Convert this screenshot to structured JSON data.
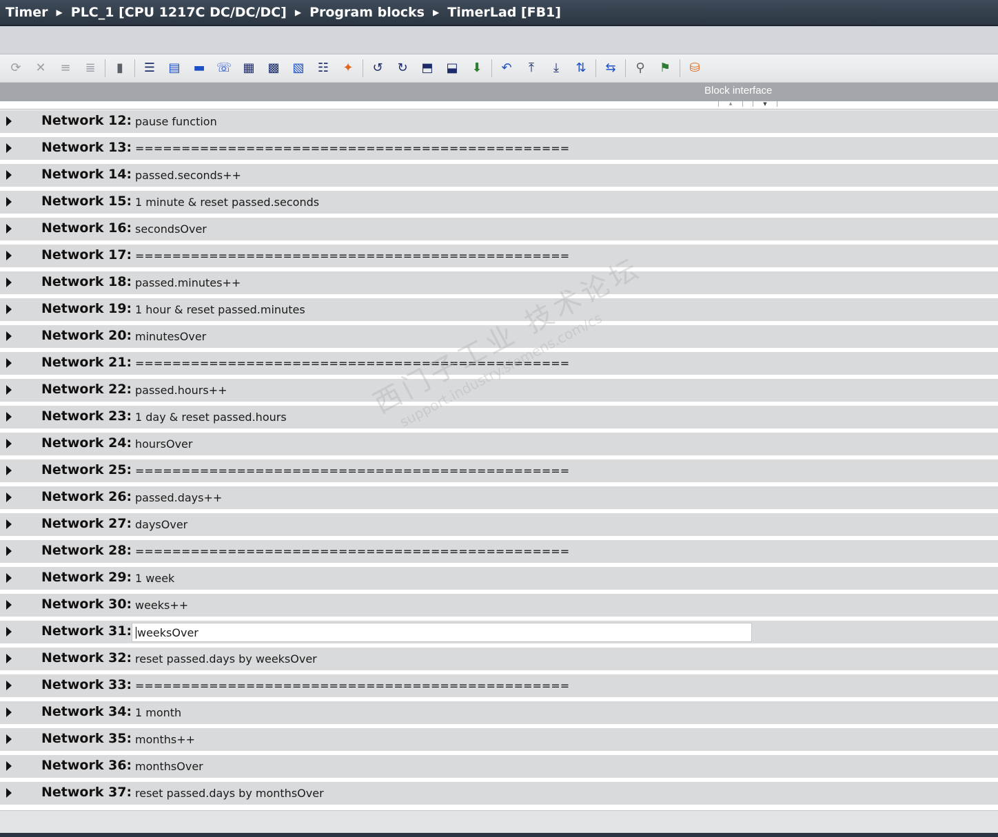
{
  "breadcrumb": [
    "Timer",
    "PLC_1 [CPU 1217C DC/DC/DC]",
    "Program blocks",
    "TimerLad [FB1]"
  ],
  "toolbar": {
    "buttons": [
      {
        "icon": "insert-network-icon",
        "glyph": "⟳",
        "tone": "dim"
      },
      {
        "icon": "delete-network-icon",
        "glyph": "✕",
        "tone": "dim"
      },
      {
        "icon": "insert-row-icon",
        "glyph": "≡",
        "tone": "dim"
      },
      {
        "icon": "append-row-icon",
        "glyph": "≣",
        "tone": "dim"
      },
      {
        "icon": "absolute-operands-icon",
        "glyph": "▮",
        "tone": "gray"
      },
      {
        "icon": "expand-all-icon",
        "glyph": "☰",
        "tone": "navy"
      },
      {
        "icon": "collapse-all-icon",
        "glyph": "▤",
        "tone": "blue"
      },
      {
        "icon": "favorites-icon",
        "glyph": "▬",
        "tone": "blue"
      },
      {
        "icon": "comments-icon",
        "glyph": "☏",
        "tone": "blue"
      },
      {
        "icon": "network-comments-icon",
        "glyph": "▦",
        "tone": "navy"
      },
      {
        "icon": "operand-view-icon",
        "glyph": "▩",
        "tone": "navy"
      },
      {
        "icon": "tag-info-icon",
        "glyph": "▧",
        "tone": "blue"
      },
      {
        "icon": "list-icon",
        "glyph": "☷",
        "tone": "navy"
      },
      {
        "icon": "snapshot-icon",
        "glyph": "✦",
        "tone": "orange"
      },
      {
        "icon": "first-cycle-icon",
        "glyph": "↺",
        "tone": "navy"
      },
      {
        "icon": "step-icon",
        "glyph": "↻",
        "tone": "navy"
      },
      {
        "icon": "load-snapshot-icon",
        "glyph": "⬒",
        "tone": "navy"
      },
      {
        "icon": "save-snapshot-icon",
        "glyph": "⬓",
        "tone": "navy"
      },
      {
        "icon": "compile-icon",
        "glyph": "⬇",
        "tone": "green"
      },
      {
        "icon": "go-to-error-icon",
        "glyph": "↶",
        "tone": "blue"
      },
      {
        "icon": "first-network-icon",
        "glyph": "⤒",
        "tone": "navy"
      },
      {
        "icon": "next-network-icon",
        "glyph": "⤓",
        "tone": "navy"
      },
      {
        "icon": "call-hierarchy-icon",
        "glyph": "⇅",
        "tone": "blue"
      },
      {
        "icon": "jump-back-icon",
        "glyph": "⇆",
        "tone": "blue"
      },
      {
        "icon": "cross-reference-icon",
        "glyph": "⚲",
        "tone": "gray"
      },
      {
        "icon": "monitoring-icon",
        "glyph": "⚑",
        "tone": "green"
      },
      {
        "icon": "database-icon",
        "glyph": "⛁",
        "tone": "orange"
      }
    ]
  },
  "interface_panel": {
    "label": "Block interface"
  },
  "networks": [
    {
      "label": "Network 12:",
      "comment": "pause function"
    },
    {
      "label": "Network 13:",
      "comment": "==============================================="
    },
    {
      "label": "Network 14:",
      "comment": "passed.seconds++"
    },
    {
      "label": "Network 15:",
      "comment": "1 minute & reset passed.seconds"
    },
    {
      "label": "Network 16:",
      "comment": "secondsOver"
    },
    {
      "label": "Network 17:",
      "comment": "==============================================="
    },
    {
      "label": "Network 18:",
      "comment": "passed.minutes++"
    },
    {
      "label": "Network 19:",
      "comment": "1 hour & reset passed.minutes"
    },
    {
      "label": "Network 20:",
      "comment": "minutesOver"
    },
    {
      "label": "Network 21:",
      "comment": "==============================================="
    },
    {
      "label": "Network 22:",
      "comment": "passed.hours++"
    },
    {
      "label": "Network 23:",
      "comment": "1 day & reset passed.hours"
    },
    {
      "label": "Network 24:",
      "comment": "hoursOver"
    },
    {
      "label": "Network 25:",
      "comment": "==============================================="
    },
    {
      "label": "Network 26:",
      "comment": "passed.days++"
    },
    {
      "label": "Network 27:",
      "comment": "daysOver"
    },
    {
      "label": "Network 28:",
      "comment": "==============================================="
    },
    {
      "label": "Network 29:",
      "comment": "1 week"
    },
    {
      "label": "Network 30:",
      "comment": "weeks++"
    },
    {
      "label": "Network 31:",
      "comment": "weeksOver",
      "editing": true
    },
    {
      "label": "Network 32:",
      "comment": "reset passed.days by weeksOver"
    },
    {
      "label": "Network 33:",
      "comment": "==============================================="
    },
    {
      "label": "Network 34:",
      "comment": "1 month"
    },
    {
      "label": "Network 35:",
      "comment": "months++"
    },
    {
      "label": "Network 36:",
      "comment": "monthsOver"
    },
    {
      "label": "Network 37:",
      "comment": "reset passed.days by monthsOver"
    }
  ],
  "watermark": {
    "main": "西门子工业 技术论坛",
    "sub": "support.industry.siemens.com/cs"
  }
}
